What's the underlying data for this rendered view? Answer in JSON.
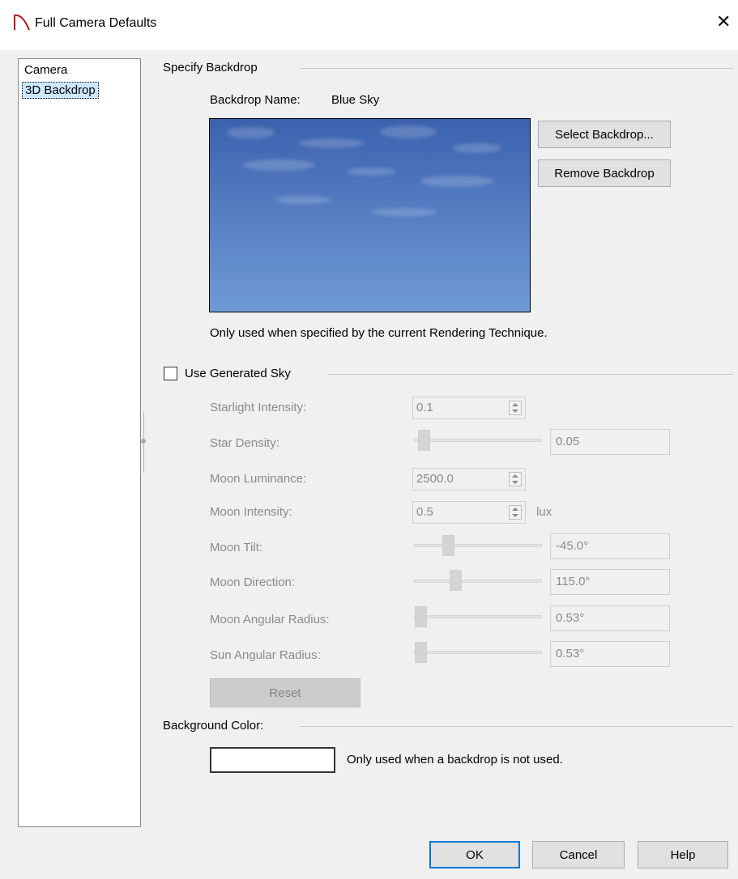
{
  "window": {
    "title": "Full Camera Defaults"
  },
  "nav": {
    "items": [
      "Camera",
      "3D Backdrop"
    ],
    "selected": 1
  },
  "backdrop_group": {
    "heading": "Specify Backdrop",
    "name_label": "Backdrop Name:",
    "name_value": "Blue Sky",
    "select_button": "Select Backdrop...",
    "remove_button": "Remove Backdrop",
    "note": "Only used when specified by the current Rendering Technique."
  },
  "sky_group": {
    "checkbox_label": "Use Generated Sky",
    "checked": false,
    "starlight_label": "Starlight Intensity:",
    "starlight_value": "0.1",
    "star_density_label": "Star Density:",
    "star_density_value": "0.05",
    "moon_luminance_label": "Moon Luminance:",
    "moon_luminance_value": "2500.0",
    "moon_intensity_label": "Moon Intensity:",
    "moon_intensity_value": "0.5",
    "moon_intensity_unit": "lux",
    "moon_tilt_label": "Moon Tilt:",
    "moon_tilt_value": "-45.0°",
    "moon_direction_label": "Moon Direction:",
    "moon_direction_value": "115.0°",
    "moon_radius_label": "Moon Angular Radius:",
    "moon_radius_value": "0.53°",
    "sun_radius_label": "Sun Angular Radius:",
    "sun_radius_value": "0.53°",
    "reset_button": "Reset"
  },
  "background_group": {
    "heading": "Background Color:",
    "swatch_color": "#ffffff",
    "note": "Only used when a backdrop is not used."
  },
  "footer": {
    "ok": "OK",
    "cancel": "Cancel",
    "help": "Help"
  }
}
